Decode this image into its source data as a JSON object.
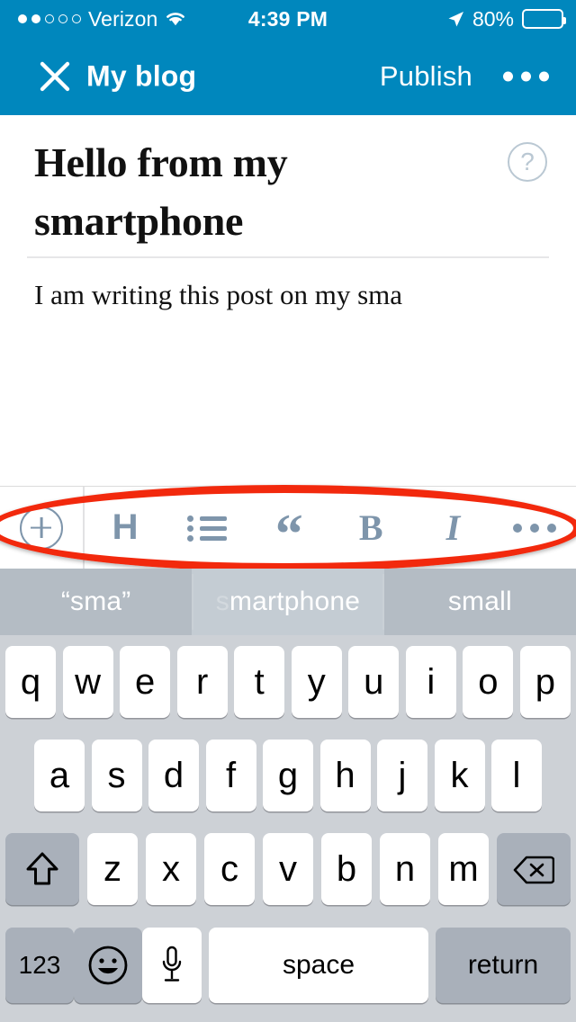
{
  "status_bar": {
    "carrier": "Verizon",
    "signal_filled_dots": 2,
    "signal_total_dots": 5,
    "wifi_icon": "wifi-icon",
    "time": "4:39 PM",
    "location_icon": "location-arrow-icon",
    "battery_percent": "80%",
    "battery_level": 80
  },
  "nav_bar": {
    "close_icon": "close-x-icon",
    "title": "My blog",
    "publish_label": "Publish",
    "more_icon": "more-ellipsis-icon",
    "background_color": "#0087bd"
  },
  "editor": {
    "post_title": "Hello from my smartphone",
    "post_body": "I am writing this post on my sma",
    "help_icon_glyph": "?",
    "help_icon_name": "help-question-icon"
  },
  "format_toolbar": {
    "accent_color": "#7e95ab",
    "items": [
      {
        "name": "add-media-button",
        "icon": "plus-circle-icon",
        "label": ""
      },
      {
        "name": "heading-button",
        "icon": "heading-icon",
        "label": "H"
      },
      {
        "name": "list-button",
        "icon": "unordered-list-icon",
        "label": ""
      },
      {
        "name": "blockquote-button",
        "icon": "quote-icon",
        "label": "“"
      },
      {
        "name": "bold-button",
        "icon": "bold-icon",
        "label": "B"
      },
      {
        "name": "italic-button",
        "icon": "italic-icon",
        "label": "I"
      },
      {
        "name": "more-format-button",
        "icon": "more-ellipsis-icon",
        "label": ""
      }
    ]
  },
  "annotation": {
    "shape": "ellipse",
    "color": "#f2290d",
    "targets": "format-toolbar"
  },
  "suggestion_bar": {
    "background_color": "#b4bcc4",
    "items": [
      {
        "text": "“sma”",
        "selected": false,
        "dim_prefix": ""
      },
      {
        "text": "smartphone",
        "selected": true,
        "dim_prefix": "s",
        "rest": "martphone"
      },
      {
        "text": "small",
        "selected": false,
        "dim_prefix": ""
      }
    ]
  },
  "keyboard": {
    "background_color": "#cdd1d6",
    "row1": [
      "q",
      "w",
      "e",
      "r",
      "t",
      "y",
      "u",
      "i",
      "o",
      "p"
    ],
    "row2": [
      "a",
      "s",
      "d",
      "f",
      "g",
      "h",
      "j",
      "k",
      "l"
    ],
    "row3_letters": [
      "z",
      "x",
      "c",
      "v",
      "b",
      "n",
      "m"
    ],
    "shift_key": {
      "name": "shift-key",
      "icon": "shift-arrow-icon"
    },
    "backspace_key": {
      "name": "backspace-key",
      "icon": "backspace-icon"
    },
    "row4": {
      "numbers_key": "123",
      "emoji_key": {
        "name": "emoji-key",
        "icon": "smiley-face-icon"
      },
      "dictation_key": {
        "name": "dictation-key",
        "icon": "microphone-icon"
      },
      "space_key": "space",
      "return_key": "return"
    }
  }
}
